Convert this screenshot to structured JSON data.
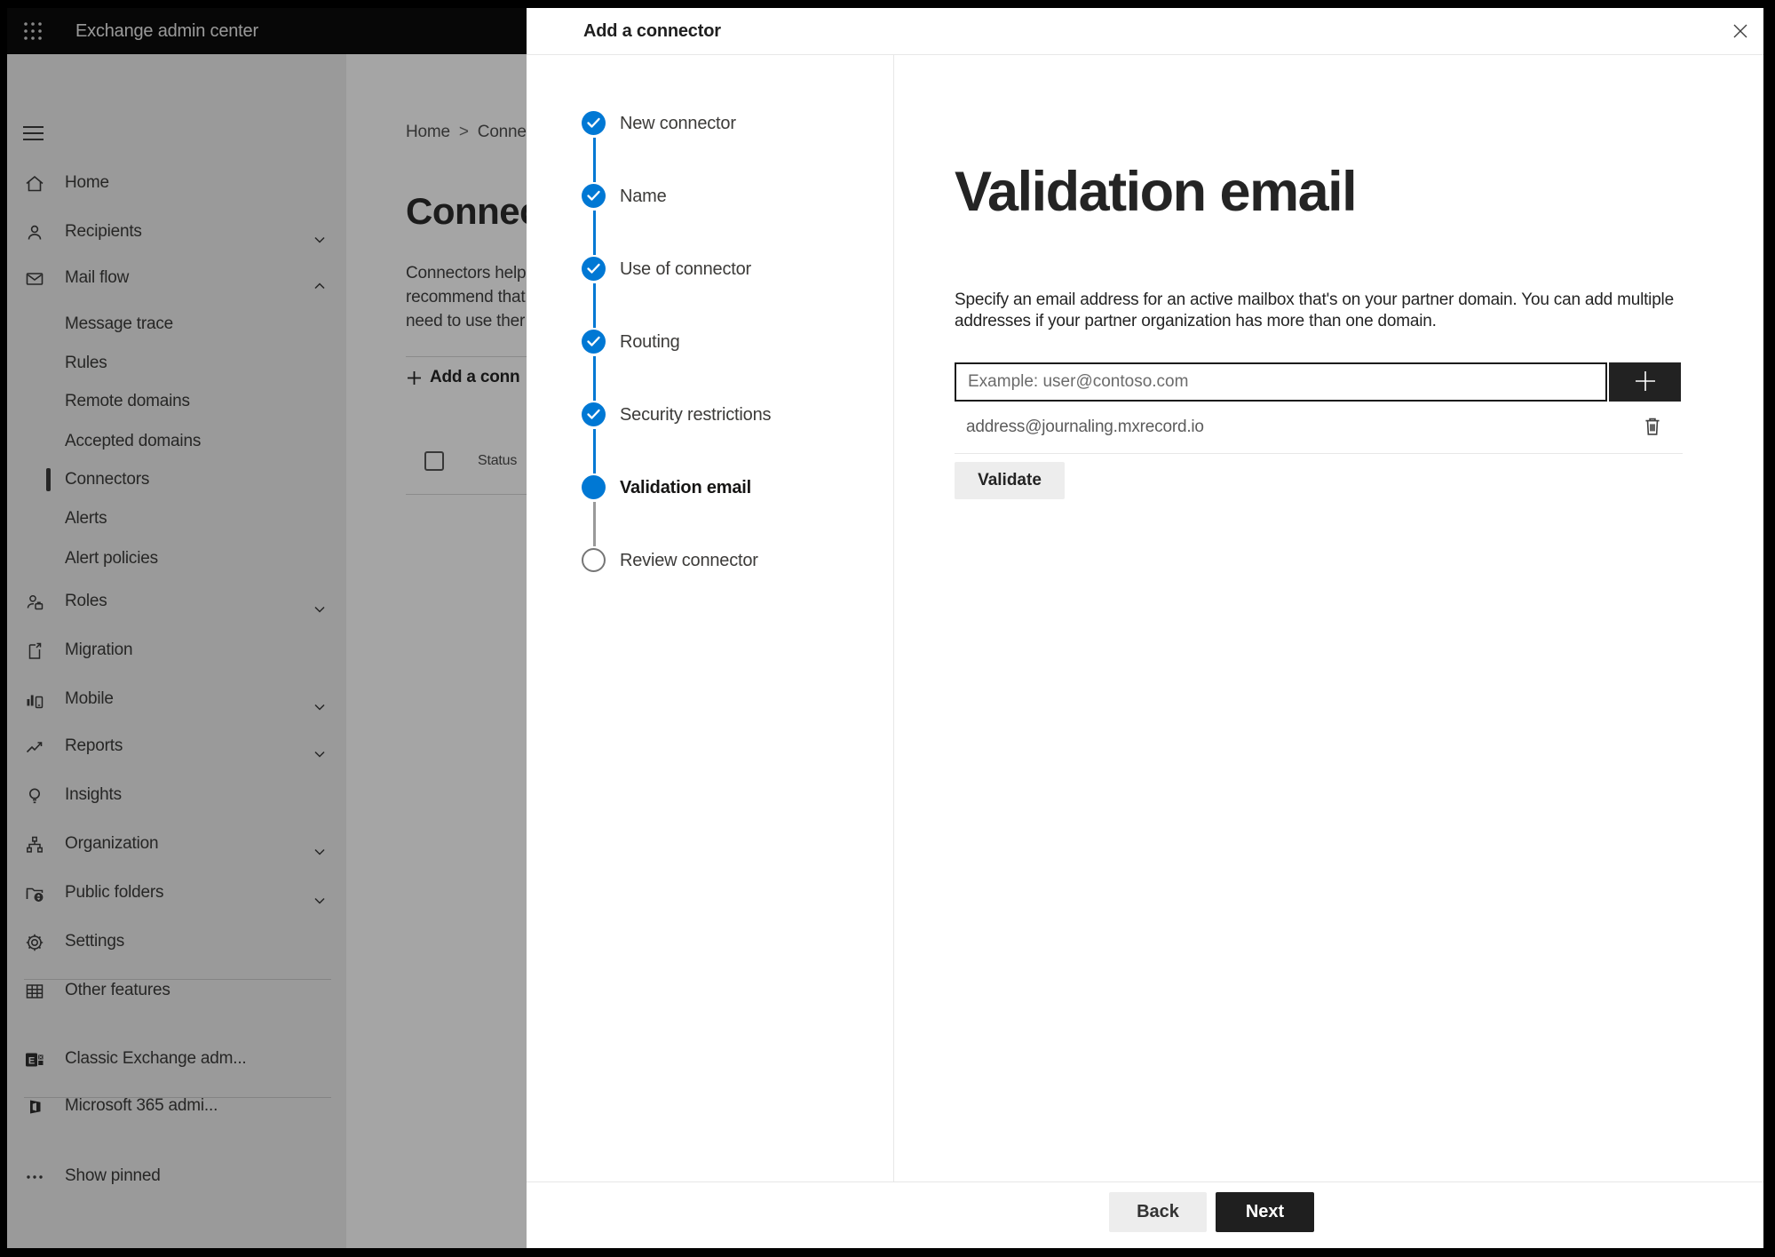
{
  "topbar": {
    "app_title": "Exchange admin center"
  },
  "sidebar": {
    "items": [
      {
        "label": "Home",
        "icon": "home"
      },
      {
        "label": "Recipients",
        "icon": "person",
        "chevron": "down"
      },
      {
        "label": "Mail flow",
        "icon": "mail",
        "chevron": "up",
        "expanded": true
      },
      {
        "label": "Message trace",
        "indent": true
      },
      {
        "label": "Rules",
        "indent": true
      },
      {
        "label": "Remote domains",
        "indent": true
      },
      {
        "label": "Accepted domains",
        "indent": true
      },
      {
        "label": "Connectors",
        "indent": true,
        "selected": true
      },
      {
        "label": "Alerts",
        "indent": true
      },
      {
        "label": "Alert policies",
        "indent": true
      },
      {
        "label": "Roles",
        "icon": "person-badge",
        "chevron": "down"
      },
      {
        "label": "Migration",
        "icon": "document-arrow"
      },
      {
        "label": "Mobile",
        "icon": "chart-phone",
        "chevron": "down"
      },
      {
        "label": "Reports",
        "icon": "line-chart",
        "chevron": "down"
      },
      {
        "label": "Insights",
        "icon": "lightbulb"
      },
      {
        "label": "Organization",
        "icon": "org-tree",
        "chevron": "down"
      },
      {
        "label": "Public folders",
        "icon": "folder-globe",
        "chevron": "down"
      },
      {
        "label": "Settings",
        "icon": "gear"
      },
      {
        "label": "Other features",
        "icon": "grid"
      },
      {
        "label": "Classic Exchange adm...",
        "icon": "exchange-logo"
      },
      {
        "label": "Microsoft 365 admi...",
        "icon": "office-logo"
      },
      {
        "label": "Show pinned",
        "icon": "ellipsis"
      }
    ]
  },
  "background_page": {
    "breadcrumb": {
      "home": "Home",
      "separator": ">",
      "current": "Conne"
    },
    "page_title": "Connec",
    "description_lines": [
      "Connectors help",
      "recommend that",
      "need to use ther"
    ],
    "add_connector_label": "Add a conn",
    "table_header_status": "Status"
  },
  "dialog": {
    "title": "Add a connector",
    "steps": [
      {
        "label": "New connector",
        "state": "completed"
      },
      {
        "label": "Name",
        "state": "completed"
      },
      {
        "label": "Use of connector",
        "state": "completed"
      },
      {
        "label": "Routing",
        "state": "completed"
      },
      {
        "label": "Security restrictions",
        "state": "completed"
      },
      {
        "label": "Validation email",
        "state": "current"
      },
      {
        "label": "Review connector",
        "state": "upcoming"
      }
    ],
    "content": {
      "heading": "Validation email",
      "description": "Specify an email address for an active mailbox that's on your partner domain. You can add multiple addresses if your partner organization has more than one domain.",
      "email_input_placeholder": "Example: user@contoso.com",
      "added_email": "address@journaling.mxrecord.io",
      "validate_button": "Validate"
    },
    "footer": {
      "back_button": "Back",
      "next_button": "Next"
    }
  },
  "colors": {
    "accent_blue": "#0078d4",
    "dark_button": "#1f1f1f",
    "topbar_bg": "#0b0b0b"
  }
}
